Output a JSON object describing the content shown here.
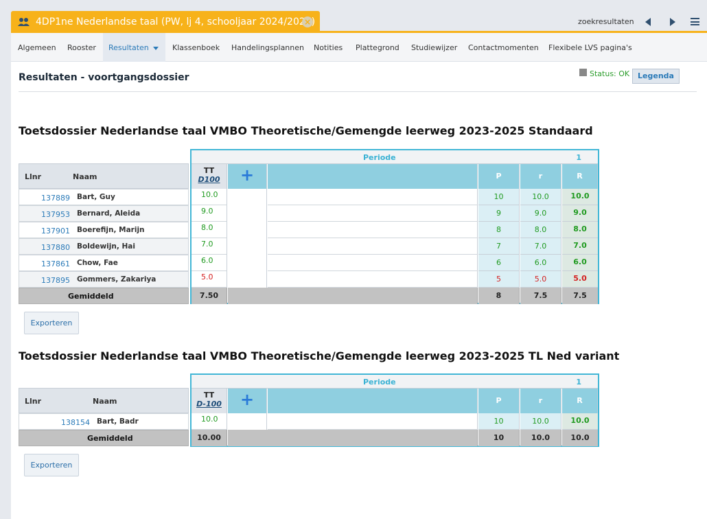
{
  "tab": {
    "title": "4DP1ne Nederlandse taal (PW, lj 4, schooljaar 2024/2025)",
    "close": "×"
  },
  "topbar": {
    "zoekresultaten": "zoekresultaten"
  },
  "subnav": [
    "Algemeen",
    "Rooster",
    "Resultaten",
    "Klassenboek",
    "Handelingsplannen",
    "Notities",
    "Plattegrond",
    "Studiewijzer",
    "Contactmomenten",
    "Flexibele LVS pagina's"
  ],
  "page": {
    "title": "Resultaten - voortgangsdossier",
    "status": "Status: OK",
    "legenda": "Legenda"
  },
  "dossiers": [
    {
      "title": "Toetsdossier Nederlandse taal VMBO Theoretische/Gemengde leerweg 2023-2025 Standaard",
      "periode_label": "Periode",
      "periode_num": "1",
      "col_llnr": "Llnr",
      "col_naam": "Naam",
      "tt_label": "TT",
      "tt_code": "D100",
      "add": "+",
      "col_p": "P",
      "col_r": "r",
      "col_R": "R",
      "rows": [
        {
          "llnr": "137889",
          "naam": "Bart, Guy",
          "tt": "10.0",
          "p": "10",
          "r": "10.0",
          "R": "10.0",
          "status": "green"
        },
        {
          "llnr": "137953",
          "naam": "Bernard, Aleida",
          "tt": "9.0",
          "p": "9",
          "r": "9.0",
          "R": "9.0",
          "status": "green"
        },
        {
          "llnr": "137901",
          "naam": "Boerefijn, Marijn",
          "tt": "8.0",
          "p": "8",
          "r": "8.0",
          "R": "8.0",
          "status": "green"
        },
        {
          "llnr": "137880",
          "naam": "Boldewijn, Hai",
          "tt": "7.0",
          "p": "7",
          "r": "7.0",
          "R": "7.0",
          "status": "green"
        },
        {
          "llnr": "137861",
          "naam": "Chow, Fae",
          "tt": "6.0",
          "p": "6",
          "r": "6.0",
          "R": "6.0",
          "status": "green"
        },
        {
          "llnr": "137895",
          "naam": "Gommers, Zakariya",
          "tt": "5.0",
          "p": "5",
          "r": "5.0",
          "R": "5.0",
          "status": "red"
        }
      ],
      "avg": {
        "label": "Gemiddeld",
        "tt": "7.50",
        "p": "8",
        "r": "7.5",
        "R": "7.5"
      },
      "export": "Exporteren"
    },
    {
      "title": "Toetsdossier Nederlandse taal VMBO Theoretische/Gemengde leerweg 2023-2025 TL Ned variant",
      "periode_label": "Periode",
      "periode_num": "1",
      "col_llnr": "Llnr",
      "col_naam": "Naam",
      "tt_label": "TT",
      "tt_code": "D-100",
      "add": "+",
      "col_p": "P",
      "col_r": "r",
      "col_R": "R",
      "rows": [
        {
          "llnr": "138154",
          "naam": "Bart, Badr",
          "tt": "10.0",
          "p": "10",
          "r": "10.0",
          "R": "10.0",
          "status": "green"
        }
      ],
      "avg": {
        "label": "Gemiddeld",
        "tt": "10.00",
        "p": "10",
        "r": "10.0",
        "R": "10.0"
      },
      "export": "Exporteren"
    }
  ],
  "colors": {
    "accent": "#f7b21a",
    "grid_border": "#41b6d6",
    "header_blue": "#8fcfe0",
    "pass": "#1f9a1f",
    "fail": "#d42020"
  }
}
